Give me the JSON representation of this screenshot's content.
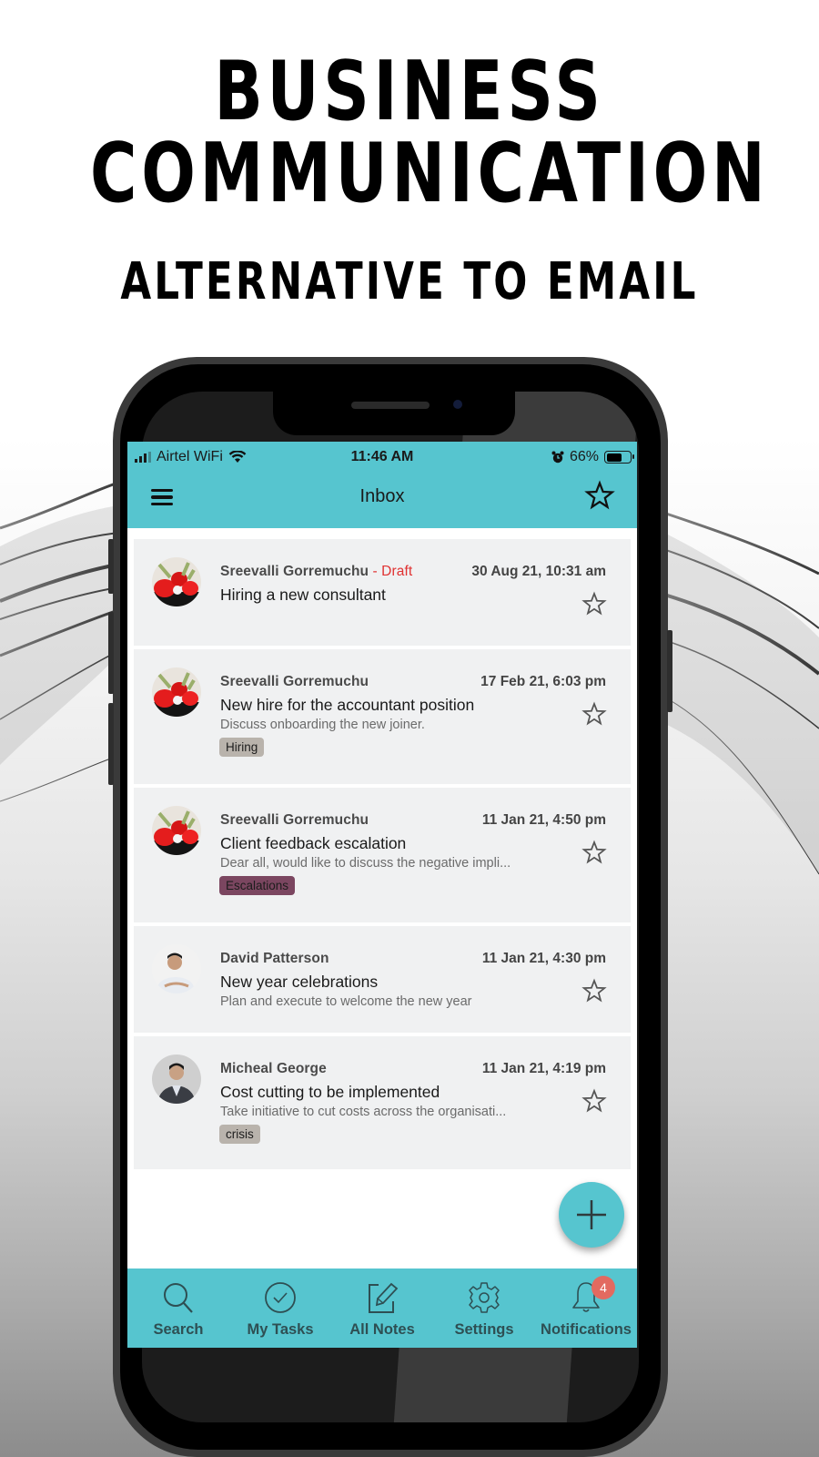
{
  "promo": {
    "headline_line1": "BUSINESS",
    "headline_line2": "COMMUNICATION",
    "subheadline": "ALTERNATIVE TO EMAIL"
  },
  "status_bar": {
    "carrier": "Airtel WiFi",
    "time": "11:46 AM",
    "battery_percent": "66%",
    "battery_level": 0.66,
    "icons": [
      "signal-icon",
      "wifi-icon",
      "alarm-icon",
      "battery-icon"
    ]
  },
  "header": {
    "title": "Inbox",
    "left_icon": "menu-icon",
    "right_icon": "star-icon"
  },
  "messages": [
    {
      "sender": "Sreevalli Gorremuchu",
      "draft_label": " - Draft",
      "date": "30 Aug 21, 10:31 am",
      "subject": "Hiring a new consultant",
      "preview": "",
      "tag": "",
      "starred": false,
      "avatar": "flowers"
    },
    {
      "sender": "Sreevalli Gorremuchu",
      "draft_label": "",
      "date": "17 Feb 21, 6:03 pm",
      "subject": "New hire for the accountant position",
      "preview": "Discuss onboarding the new joiner.",
      "tag": "Hiring",
      "tag_color": "#b9b3ac",
      "starred": false,
      "avatar": "flowers"
    },
    {
      "sender": "Sreevalli Gorremuchu",
      "draft_label": "",
      "date": "11 Jan 21, 4:50 pm",
      "subject": "Client feedback escalation",
      "preview": "Dear all, would like to discuss the negative impli...",
      "tag": "Escalations",
      "tag_color": "#7b4660",
      "starred": false,
      "avatar": "flowers"
    },
    {
      "sender": "David Patterson",
      "draft_label": "",
      "date": "11 Jan 21, 4:30 pm",
      "subject": "New year celebrations",
      "preview": "Plan and execute to welcome the new year",
      "tag": "",
      "starred": false,
      "avatar": "person-white-shirt"
    },
    {
      "sender": "Micheal George",
      "draft_label": "",
      "date": "11 Jan 21, 4:19 pm",
      "subject": "Cost cutting to be implemented",
      "preview": "Take initiative to cut costs across the organisati...",
      "tag": "crisis",
      "tag_color": "#b9b3ac",
      "starred": false,
      "avatar": "person-suit"
    }
  ],
  "fab": {
    "icon": "plus-icon"
  },
  "tabs": [
    {
      "label": "Search",
      "icon": "search-icon"
    },
    {
      "label": "My Tasks",
      "icon": "check-circle-icon"
    },
    {
      "label": "All Notes",
      "icon": "edit-note-icon"
    },
    {
      "label": "Settings",
      "icon": "gear-icon"
    },
    {
      "label": "Notifications",
      "icon": "bell-icon",
      "badge": "4"
    }
  ],
  "colors": {
    "accent": "#56c5cf",
    "draft": "#e03232",
    "badge": "#e26a60",
    "card_bg": "#f0f1f2"
  }
}
